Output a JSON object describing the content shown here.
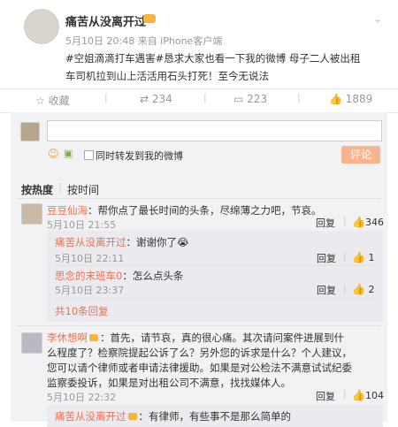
{
  "post": {
    "username": "痛苦从没离开过",
    "meta": "5月10日 20:48 来自 iPhone客户端",
    "line1": "#空姐滴滴打车遇害#恳求大家也看一下我的微博 母子二人被出租",
    "line2": "车司机拉到山上活活用石头打死！至今无说法"
  },
  "actions": {
    "collect": "收藏",
    "repost": "234",
    "comment": "223",
    "like": "1889"
  },
  "composer": {
    "checkbox_label": "同时转发到我的微博",
    "submit": "评论"
  },
  "sort": {
    "hot": "按热度",
    "time": "按时间"
  },
  "comments": [
    {
      "name": "豆豆仙海",
      "text": "：帮你点了最长时间的头条，尽绵薄之力吧，节哀。",
      "time": "5月10日 21:55",
      "reply": "回复",
      "likes": "346"
    },
    {
      "name": "李休想啊",
      "text1": "：首先，请节哀，真的很心痛。其次请问案件进展到什",
      "text2": "么程度了？检察院提起公诉了么？另外您的诉求是什么？个人建议，",
      "text3": "您可以请个律师或者申请法律援助。如果是对公检法不满意试试纪委",
      "text4": "监察委投诉，如果是对出租公司不满意，找找媒体人。",
      "time": "5月10日 22:32",
      "reply": "回复",
      "likes": "104"
    }
  ],
  "replies": [
    {
      "name": "痛苦从没离开过",
      "text": "：谢谢你了😭",
      "time": "5月10日 22:11",
      "reply": "回复",
      "likes": "1"
    },
    {
      "name": "思念的末班车0",
      "text": "：怎么点头条",
      "time": "5月10日 23:37",
      "reply": "回复",
      "likes": "2"
    }
  ],
  "more_replies": "共10条回复",
  "last_reply": {
    "name": "痛苦从没离开过",
    "text": "：有律师，有些事不是那么简单的"
  }
}
